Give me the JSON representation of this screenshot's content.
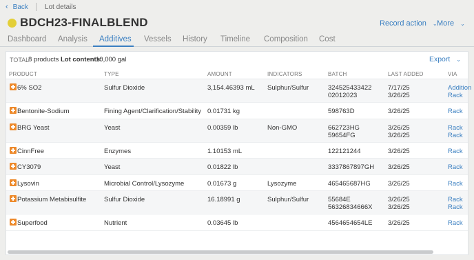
{
  "nav": {
    "back_label": "Back",
    "page_title": "Lot details"
  },
  "lot": {
    "code": "BDCH23-FINALBLEND",
    "status_color": "#e3cf38"
  },
  "header_actions": {
    "record_action": "Record action",
    "more": "More"
  },
  "tabs": [
    {
      "label": "Dashboard"
    },
    {
      "label": "Analysis"
    },
    {
      "label": "Additives"
    },
    {
      "label": "Vessels"
    },
    {
      "label": "History"
    },
    {
      "label": "Timeline"
    },
    {
      "label": "Composition"
    },
    {
      "label": "Cost"
    }
  ],
  "active_tab": "Additives",
  "summary": {
    "total_label": "TOTAL",
    "total_value": "8 products",
    "contents_label": "Lot contents:",
    "contents_value": "10,000 gal",
    "export_label": "Export"
  },
  "columns": {
    "product": "PRODUCT",
    "type": "TYPE",
    "amount": "AMOUNT",
    "indicators": "INDICATORS",
    "batch": "BATCH",
    "last_added": "LAST ADDED",
    "via": "VIA"
  },
  "rows": [
    {
      "product": "6% SO2",
      "type": "Sulfur Dioxide",
      "amount": "3,154.46393 mL",
      "indicators": "Sulphur/Sulfur",
      "batch": [
        "324525433422",
        "02012023"
      ],
      "last_added": [
        "7/17/25",
        "3/26/25"
      ],
      "via": [
        "Addition",
        "Rack"
      ]
    },
    {
      "product": "Bentonite-Sodium",
      "type": "Fining Agent/Clarification/Stability",
      "amount": "0.01731 kg",
      "indicators": "",
      "batch": [
        "598763D"
      ],
      "last_added": [
        "3/26/25"
      ],
      "via": [
        "Rack"
      ]
    },
    {
      "product": "BRG Yeast",
      "type": "Yeast",
      "amount": "0.00359 lb",
      "indicators": "Non-GMO",
      "batch": [
        "662723HG",
        "59654FG"
      ],
      "last_added": [
        "3/26/25",
        "3/26/25"
      ],
      "via": [
        "Rack",
        "Rack"
      ]
    },
    {
      "product": "CinnFree",
      "type": "Enzymes",
      "amount": "1.10153 mL",
      "indicators": "",
      "batch": [
        "122121244"
      ],
      "last_added": [
        "3/26/25"
      ],
      "via": [
        "Rack"
      ]
    },
    {
      "product": "CY3079",
      "type": "Yeast",
      "amount": "0.01822 lb",
      "indicators": "",
      "batch": [
        "3337867897GH"
      ],
      "last_added": [
        "3/26/25"
      ],
      "via": [
        "Rack"
      ]
    },
    {
      "product": "Lysovin",
      "type": "Microbial Control/Lysozyme",
      "amount": "0.01673 g",
      "indicators": "Lysozyme",
      "batch": [
        "465465687HG"
      ],
      "last_added": [
        "3/26/25"
      ],
      "via": [
        "Rack"
      ]
    },
    {
      "product": "Potassium Metabisulfite",
      "type": "Sulfur Dioxide",
      "amount": "16.18991 g",
      "indicators": "Sulphur/Sulfur",
      "batch": [
        "55684E",
        "56326834666X"
      ],
      "last_added": [
        "3/26/25",
        "3/26/25"
      ],
      "via": [
        "Rack",
        "Rack"
      ]
    },
    {
      "product": "Superfood",
      "type": "Nutrient",
      "amount": "0.03645 lb",
      "indicators": "",
      "batch": [
        "4564654654LE"
      ],
      "last_added": [
        "3/26/25"
      ],
      "via": [
        "Rack"
      ]
    }
  ],
  "colors": {
    "accent": "#3a7fc1",
    "add_icon": "#ed8a2c"
  },
  "icons": {
    "back": "chevron-left-icon",
    "dropdown": "chevron-down-icon",
    "row": "add-square-icon"
  }
}
